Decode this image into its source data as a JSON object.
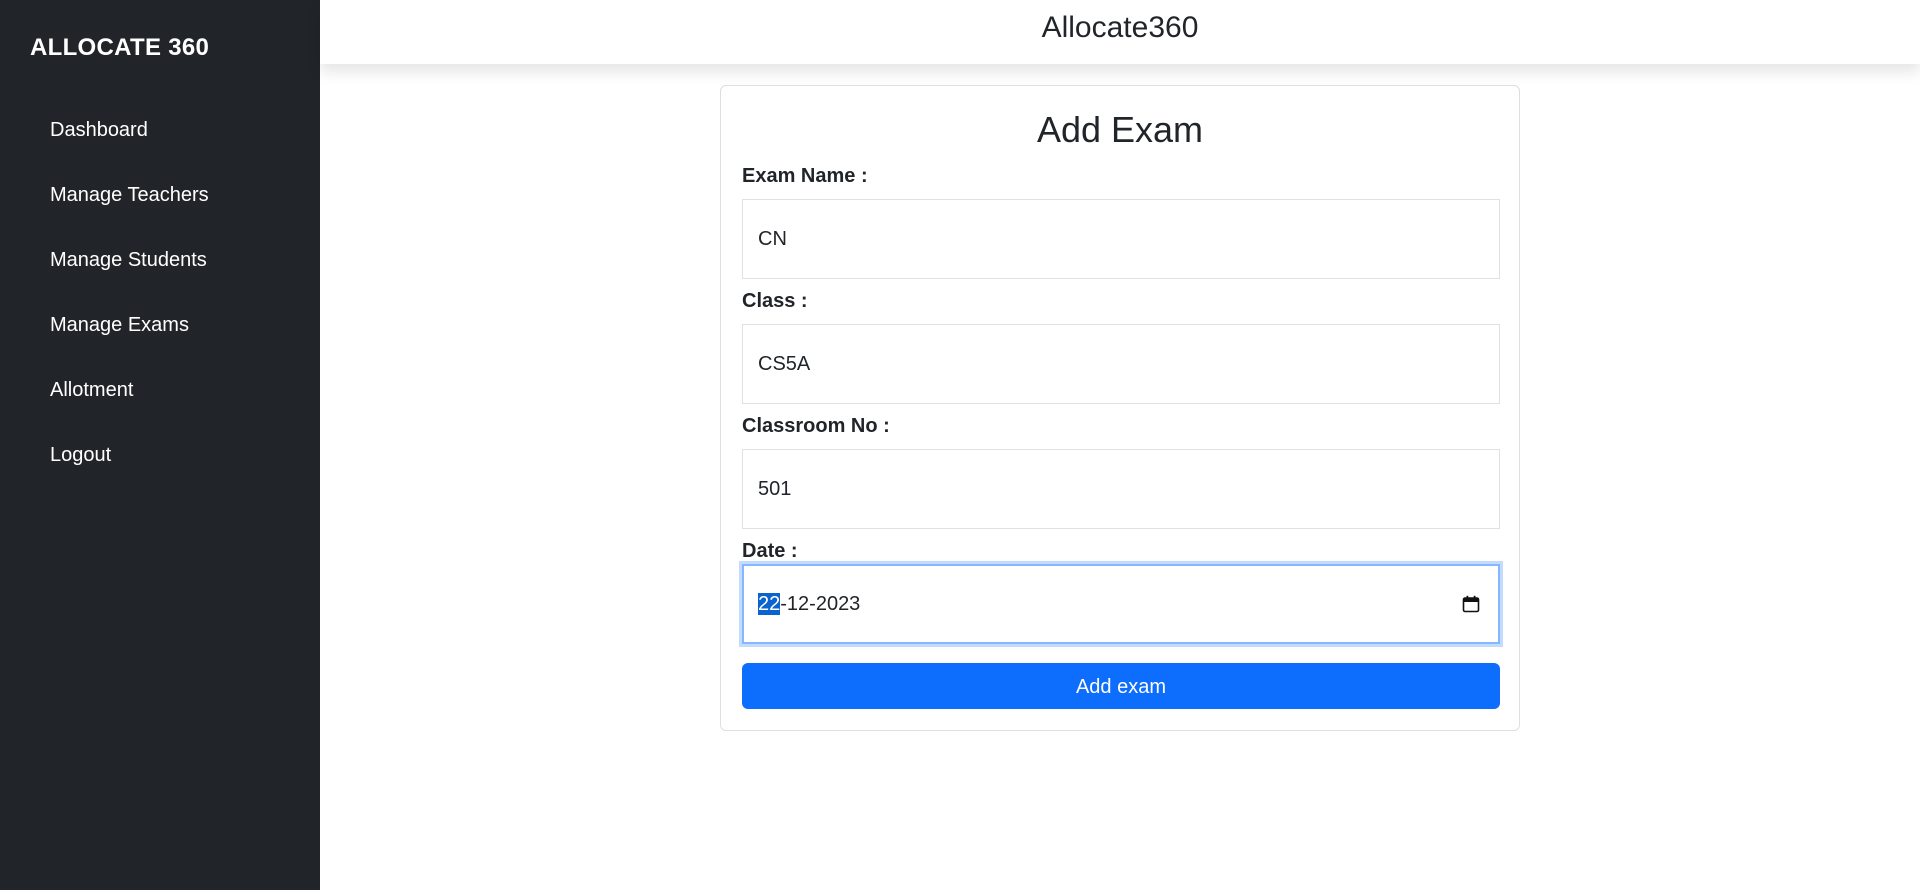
{
  "sidebar": {
    "brand": "ALLOCATE 360",
    "items": [
      {
        "label": "Dashboard"
      },
      {
        "label": "Manage Teachers"
      },
      {
        "label": "Manage Students"
      },
      {
        "label": "Manage Exams"
      },
      {
        "label": "Allotment"
      },
      {
        "label": "Logout"
      }
    ]
  },
  "header": {
    "title": "Allocate360"
  },
  "form": {
    "title": "Add Exam",
    "exam_name": {
      "label": "Exam Name :",
      "value": "CN"
    },
    "class": {
      "label": "Class :",
      "value": "CS5A"
    },
    "classroom_no": {
      "label": "Classroom No :",
      "value": "501"
    },
    "date": {
      "label": "Date :",
      "day": "22",
      "rest": "-12-2023",
      "icon": "calendar-icon"
    },
    "submit_label": "Add exam"
  },
  "colors": {
    "sidebar_bg": "#212529",
    "accent": "#0d6efd",
    "focus_border": "#86b7fe"
  }
}
